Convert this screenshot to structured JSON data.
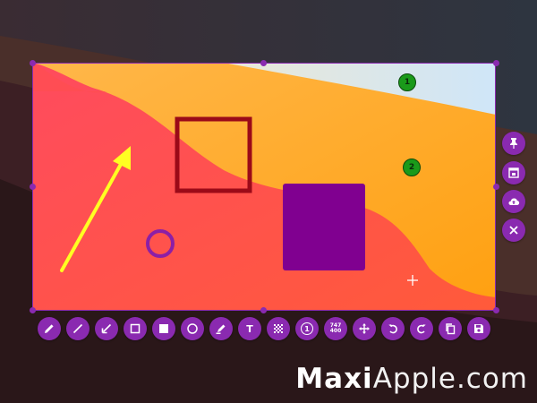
{
  "annotations": {
    "badge_1": "1",
    "badge_2": "2"
  },
  "colors": {
    "accent": "#8a2ab0",
    "arrow": "#ffff22",
    "rect_outline": "#9b0a18",
    "rect_fill": "#800090",
    "circle": "#8c1fa6",
    "badge": "#1a9a1a"
  },
  "toolbar": {
    "items": [
      {
        "icon": "pencil-icon"
      },
      {
        "icon": "line-icon"
      },
      {
        "icon": "arrow-icon"
      },
      {
        "icon": "rectangle-outline-icon"
      },
      {
        "icon": "rectangle-filled-icon"
      },
      {
        "icon": "circle-icon"
      },
      {
        "icon": "marker-icon"
      },
      {
        "icon": "text-icon",
        "label": "T"
      },
      {
        "icon": "blur-icon"
      },
      {
        "icon": "counter-icon",
        "label": "1"
      },
      {
        "icon": "resolution-icon",
        "width": "747",
        "height": "400"
      },
      {
        "icon": "move-icon"
      },
      {
        "icon": "undo-icon"
      },
      {
        "icon": "redo-icon"
      },
      {
        "icon": "copy-icon"
      },
      {
        "icon": "save-icon"
      }
    ]
  },
  "side_toolbar": {
    "items": [
      {
        "icon": "pin-icon"
      },
      {
        "icon": "open-window-icon"
      },
      {
        "icon": "cloud-upload-icon"
      },
      {
        "icon": "close-icon"
      }
    ]
  },
  "watermark": {
    "part_bold": "Maxi",
    "part_light": "Apple",
    "suffix": ".com"
  }
}
